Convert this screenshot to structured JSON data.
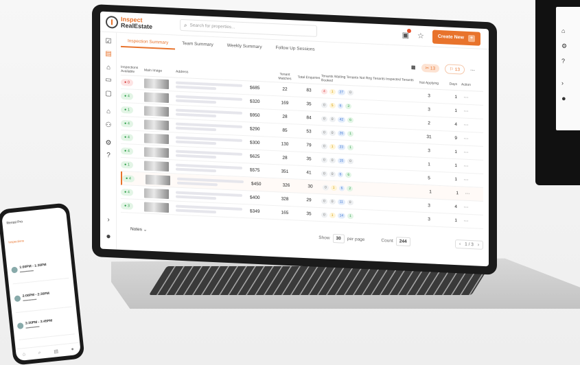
{
  "app": {
    "logo_line1": "Inspect",
    "logo_line2": "RealEstate",
    "search_placeholder": "Search for properties...",
    "create_button": "Create New",
    "accent": "#e8732c"
  },
  "tabs": [
    {
      "label": "Inspection Summary",
      "active": true
    },
    {
      "label": "Team Summary",
      "active": false
    },
    {
      "label": "Weekly Summary",
      "active": false
    },
    {
      "label": "Follow Up Sessions",
      "active": false
    }
  ],
  "toolbar": {
    "filter_count": "13",
    "people_count": "13"
  },
  "table": {
    "headers": [
      "Inspections Available",
      "Main Image",
      "Address",
      "",
      "Tenant Matches",
      "Total Enquiries",
      "Tenants Waiting  Tenants Not Reg  Tenants Inspected  Tenants Booked",
      "Not Applying",
      "Days",
      "Action"
    ],
    "rows": [
      {
        "badge": "0",
        "badge_color": "red",
        "price": "$685",
        "matches": "22",
        "enquiries": "83",
        "not_applying": "3",
        "days": "1",
        "stats": [
          "4",
          "1",
          "27",
          "0"
        ]
      },
      {
        "badge": "4",
        "badge_color": "green",
        "price": "$320",
        "matches": "169",
        "enquiries": "35",
        "not_applying": "3",
        "days": "1",
        "stats": [
          "0",
          "5",
          "6",
          "3"
        ]
      },
      {
        "badge": "1",
        "badge_color": "green",
        "price": "$950",
        "matches": "28",
        "enquiries": "84",
        "not_applying": "2",
        "days": "4",
        "stats": [
          "0",
          "0",
          "42",
          "6"
        ]
      },
      {
        "badge": "4",
        "badge_color": "green",
        "price": "$290",
        "matches": "85",
        "enquiries": "53",
        "not_applying": "31",
        "days": "9",
        "stats": [
          "0",
          "0",
          "26",
          "1"
        ]
      },
      {
        "badge": "4",
        "badge_color": "green",
        "price": "$300",
        "matches": "130",
        "enquiries": "79",
        "not_applying": "3",
        "days": "1",
        "stats": [
          "0",
          "1",
          "23",
          "1"
        ]
      },
      {
        "badge": "4",
        "badge_color": "green",
        "price": "$625",
        "matches": "28",
        "enquiries": "35",
        "not_applying": "1",
        "days": "1",
        "stats": [
          "0",
          "0",
          "15",
          "0"
        ]
      },
      {
        "badge": "1",
        "badge_color": "green",
        "price": "$575",
        "matches": "351",
        "enquiries": "41",
        "not_applying": "5",
        "days": "1",
        "stats": [
          "0",
          "0",
          "6",
          "6"
        ]
      },
      {
        "badge": "4",
        "badge_color": "green",
        "price": "$450",
        "matches": "326",
        "enquiries": "30",
        "not_applying": "1",
        "days": "1",
        "stats": [
          "0",
          "1",
          "6",
          "2"
        ],
        "highlight": true
      },
      {
        "badge": "4",
        "badge_color": "green",
        "price": "$400",
        "matches": "328",
        "enquiries": "29",
        "not_applying": "3",
        "days": "4",
        "stats": [
          "0",
          "0",
          "11",
          "0"
        ]
      },
      {
        "badge": "3",
        "badge_color": "green",
        "price": "$349",
        "matches": "165",
        "enquiries": "35",
        "not_applying": "3",
        "days": "1",
        "stats": [
          "0",
          "1",
          "14",
          "1"
        ]
      }
    ]
  },
  "footer": {
    "notes": "Notes",
    "show_label": "Show",
    "show_value": "30",
    "per_page": "per page",
    "count_label": "Count",
    "count_value": "244",
    "pager": "1 / 3"
  },
  "monitor": {
    "icons": [
      "home-icon",
      "settings-icon",
      "help-icon",
      "collapse-icon",
      "user-icon"
    ]
  },
  "phone": {
    "title": "Rental Pro",
    "tab": "Inspections",
    "cards": [
      {
        "time": "1:00PM - 1:30PM"
      },
      {
        "time": "2:00PM - 2:30PM"
      },
      {
        "time": "3:30PM - 3:45PM"
      }
    ]
  }
}
